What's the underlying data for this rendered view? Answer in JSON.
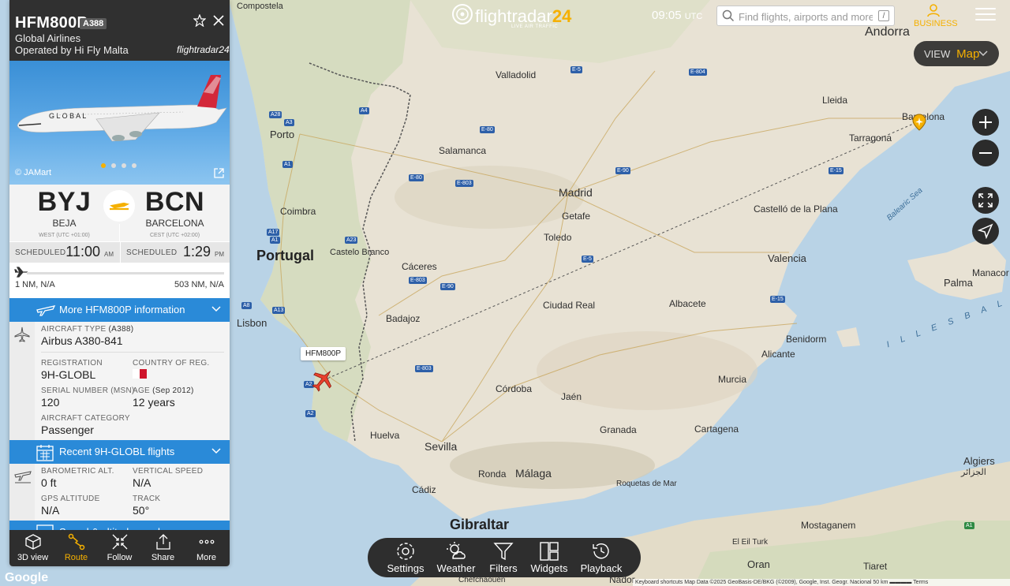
{
  "topbar": {
    "brand": "flightradar",
    "brand_num": "24",
    "brand_tag": "LIVE AIR TRAFFIC",
    "time": "09:05",
    "time_zone": "UTC",
    "search_placeholder": "Find flights, airports and more",
    "search_shortcut": "/",
    "business_label": "BUSINESS",
    "view_label": "VIEW",
    "view_value": "Map"
  },
  "panel": {
    "callsign": "HFM800P",
    "aircraft_code": "A388",
    "airline": "Global Airlines",
    "operated_by": "Operated by Hi Fly Malta",
    "brand_small": "flightradar24",
    "photo_credit": "© JAMart",
    "photo_livery": "G L O B A L",
    "origin": {
      "code": "BYJ",
      "city": "BEJA",
      "tz": "WEST (UTC +01:00)"
    },
    "destination": {
      "code": "BCN",
      "city": "BARCELONA",
      "tz": "CEST (UTC +02:00)"
    },
    "dep": {
      "label": "SCHEDULED",
      "time": "11:00",
      "ampm": "AM"
    },
    "arr": {
      "label": "SCHEDULED",
      "time": "1:29",
      "ampm": "PM"
    },
    "progress_fraction": 0.0,
    "dist_flown": "1 NM, N/A",
    "dist_remaining": "503 NM, N/A",
    "more_info_label": "More HFM800P information",
    "aircraft_type_label": "AIRCRAFT TYPE",
    "aircraft_type_code": "(A388)",
    "aircraft_type": "Airbus A380-841",
    "registration_label": "REGISTRATION",
    "registration": "9H-GLOBL",
    "country_label": "COUNTRY OF REG.",
    "serial_label": "SERIAL NUMBER (MSN)",
    "serial": "120",
    "age_label": "AGE",
    "age_date": "(Sep 2012)",
    "age": "12 years",
    "category_label": "AIRCRAFT CATEGORY",
    "category": "Passenger",
    "recent_flights_label": "Recent 9H-GLOBL flights",
    "baro_label": "BAROMETRIC ALT.",
    "baro": "0 ft",
    "vspeed_label": "VERTICAL SPEED",
    "vspeed": "N/A",
    "gps_label": "GPS ALTITUDE",
    "gps": "N/A",
    "track_label": "TRACK",
    "track": "50°",
    "speed_section_label": "Speed & altitude graph"
  },
  "panel_nav": [
    {
      "label": "3D view",
      "icon": "cube-icon"
    },
    {
      "label": "Route",
      "icon": "route-icon"
    },
    {
      "label": "Follow",
      "icon": "follow-icon"
    },
    {
      "label": "Share",
      "icon": "share-icon"
    },
    {
      "label": "More",
      "icon": "more-icon"
    }
  ],
  "toolbar": [
    {
      "label": "Settings",
      "icon": "gear-icon"
    },
    {
      "label": "Weather",
      "icon": "weather-icon"
    },
    {
      "label": "Filters",
      "icon": "filter-icon"
    },
    {
      "label": "Widgets",
      "icon": "widgets-icon"
    },
    {
      "label": "Playback",
      "icon": "playback-icon"
    }
  ],
  "map": {
    "flight_tag": "HFM800P",
    "labels": {
      "andorra": "Andorra",
      "lleida": "Lleida",
      "barcelona": "Barcelona",
      "tarragona": "Tarragona",
      "valladolid": "Valladolid",
      "porto": "Porto",
      "salamanca": "Salamanca",
      "madrid": "Madrid",
      "getafe": "Getafe",
      "coimbra": "Coimbra",
      "toledo": "Toledo",
      "valencia": "Valencia",
      "castellon": "Castelló de la Plana",
      "portugal": "Portugal",
      "castelo": "Castelo Branco",
      "caceres": "Cáceres",
      "lisbon": "Lisbon",
      "badajoz": "Badajoz",
      "ciudadreal": "Ciudad Real",
      "albacete": "Albacete",
      "palma": "Palma",
      "manacor": "Manacor",
      "benidorm": "Benidorm",
      "alicante": "Alicante",
      "murcia": "Murcia",
      "cordoba": "Córdoba",
      "jaen": "Jaén",
      "granada": "Granada",
      "cartagena": "Cartagena",
      "huelva": "Huelva",
      "seville": "Sevilla",
      "malaga": "Málaga",
      "ronda": "Ronda",
      "roquetas": "Roquetas\nde Mar",
      "cadiz": "Cádiz",
      "gibraltar": "Gibraltar",
      "algiers": "Algiers",
      "algiers_ar": "الجزائر",
      "mostaganem": "Mostaganem",
      "oran": "Oran",
      "tiaret": "Tiaret",
      "chefchaouen": "Chefchaouen",
      "nador": "Nador",
      "balearic_sea": "Balearic Sea",
      "illes_balears": "I L L E S   B A L E A R S",
      "composta": "Compostela",
      "eleljtuk": "El Eil Turk"
    }
  },
  "footer": {
    "google": "Google",
    "attribution": "Keyboard shortcuts   Map Data ©2025 GeoBasis-DE/BKG (©2009), Google, Inst. Geogr. Nacional   50 km ▬▬▬▬   Terms"
  },
  "colors": {
    "accent": "#f5b000",
    "section_blue": "#2a8ad8",
    "panel_dark": "#303030",
    "aircraft": "#e8402c"
  }
}
